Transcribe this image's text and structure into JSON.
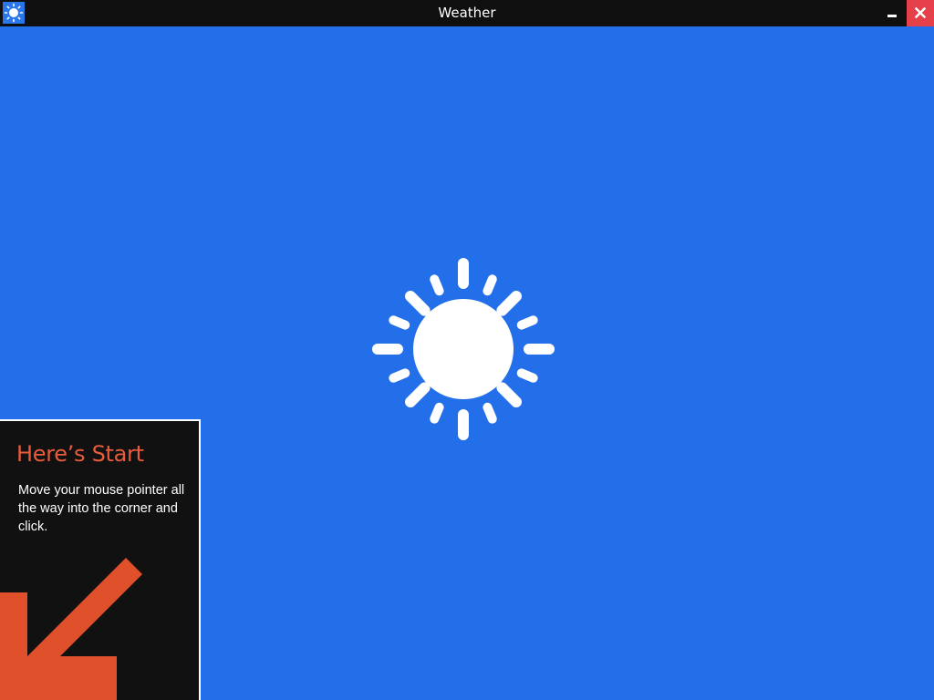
{
  "window": {
    "title": "Weather",
    "app_icon": "sun-icon",
    "controls": {
      "minimize": "minimize-icon",
      "close": "close-icon"
    }
  },
  "splash": {
    "background": "#236fe9",
    "logo": "sun-icon",
    "logo_color": "#ffffff"
  },
  "start_tip": {
    "title": "Here’s Start",
    "body": "Move your mouse pointer all the way into the corner and click.",
    "arrow": "arrow-down-left-icon",
    "title_color": "#e85b3b",
    "arrow_color": "#e0502a"
  },
  "colors": {
    "titlebar": "#0f0f0f",
    "close_button": "#e5404a"
  }
}
